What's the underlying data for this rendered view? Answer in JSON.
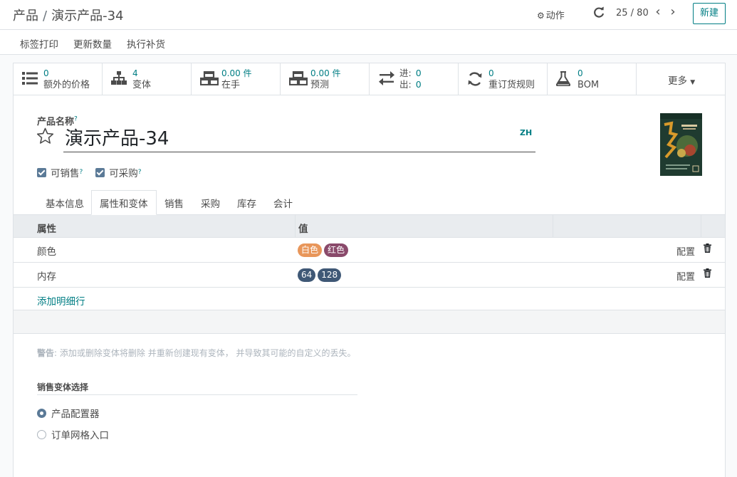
{
  "breadcrumb": {
    "parent": "产品",
    "separator": "/",
    "current": "演示产品-34"
  },
  "control": {
    "action_label": "动作",
    "pager_value": "25 / 80",
    "new_label": "新建"
  },
  "statusbar": {
    "buttons": [
      "标签打印",
      "更新数量",
      "执行补货"
    ]
  },
  "smart_buttons": [
    {
      "icon": "list-icon",
      "value": "0",
      "label": "额外的价格"
    },
    {
      "icon": "sitemap-icon",
      "value": "4",
      "label": "变体"
    },
    {
      "icon": "cubes-icon",
      "value": "0.00 件",
      "label": "在手"
    },
    {
      "icon": "cubes-icon",
      "value": "0.00 件",
      "label": "预测"
    },
    {
      "icon": "exchange-icon",
      "in_label": "进:",
      "in_value": "0",
      "out_label": "出:",
      "out_value": "0"
    },
    {
      "icon": "refresh-icon",
      "value": "0",
      "label": "重订货规则"
    },
    {
      "icon": "flask-icon",
      "value": "0",
      "label": "BOM"
    },
    {
      "more_label": "更多"
    }
  ],
  "form": {
    "name_label": "产品名称",
    "help_mark": "?",
    "name_value": "演示产品-34",
    "lang": "ZH",
    "can_sell_label": "可销售",
    "can_purchase_label": "可采购"
  },
  "tabs": [
    "基本信息",
    "属性和变体",
    "销售",
    "采购",
    "库存",
    "会计"
  ],
  "attributes_table": {
    "headers": {
      "attribute": "属性",
      "value": "值"
    },
    "rows": [
      {
        "name": "颜色",
        "tags": [
          {
            "text": "白色",
            "color": "#e8965a"
          },
          {
            "text": "红色",
            "color": "#8a4a6b"
          }
        ],
        "configure": "配置"
      },
      {
        "name": "内存",
        "tags": [
          {
            "text": "64",
            "color": "#3f5876"
          },
          {
            "text": "128",
            "color": "#3f5876"
          }
        ],
        "configure": "配置"
      }
    ],
    "add_line": "添加明细行"
  },
  "warning": {
    "prefix": "警告",
    "text": ": 添加或删除变体将删除 并重新创建现有变体， 并导致其可能的自定义的丢失。"
  },
  "sales_variant": {
    "title": "销售变体选择",
    "options": [
      {
        "label": "产品配置器",
        "selected": true
      },
      {
        "label": "订单网格入口",
        "selected": false
      }
    ]
  },
  "colors": {
    "accent": "#017e84",
    "checkbox": "#5b7a97"
  }
}
